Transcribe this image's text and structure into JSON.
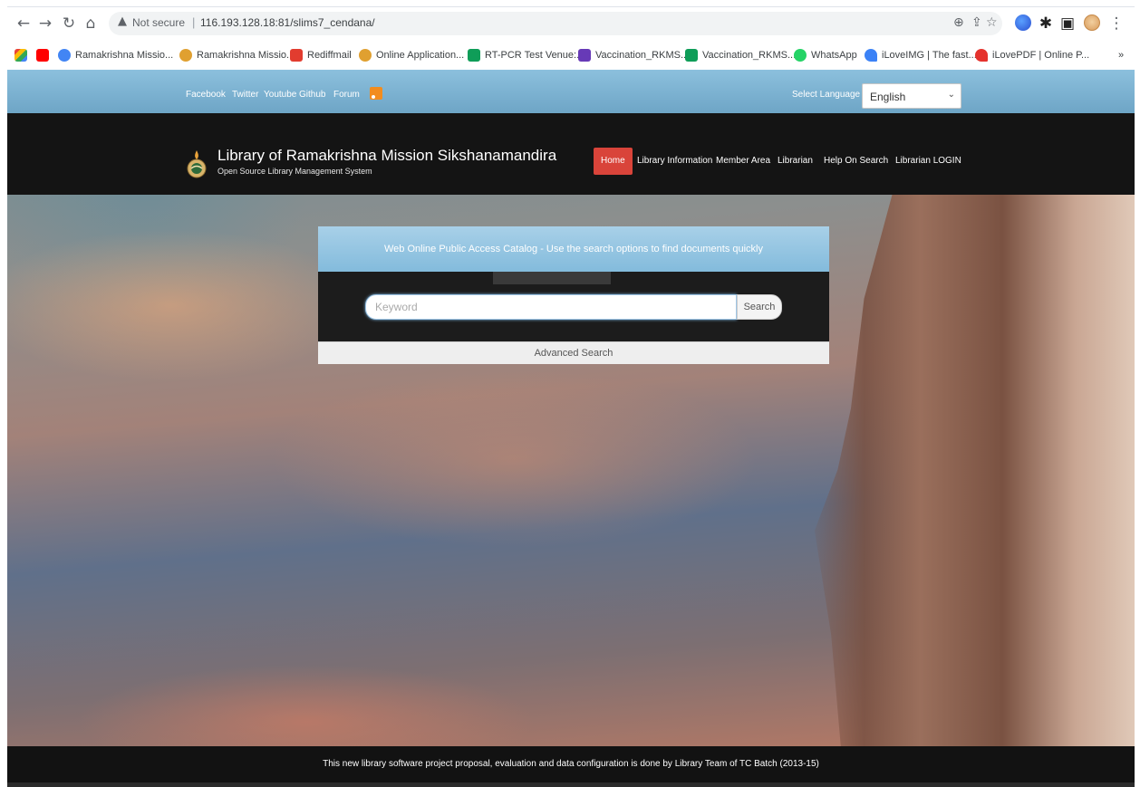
{
  "browser": {
    "security_label": "Not secure",
    "url": "116.193.128.18:81/slims7_cendana/",
    "bookmarks": [
      {
        "label": "Ramakrishna Missio...",
        "color": "#4285f4"
      },
      {
        "label": "Ramakrishna Missio...",
        "color": "#e0a030"
      },
      {
        "label": "Rediffmail",
        "color": "#e23c2f"
      },
      {
        "label": "Online Application...",
        "color": "#e0a030"
      },
      {
        "label": "RT-PCR Test Venue:...",
        "color": "#0f9d58"
      },
      {
        "label": "Vaccination_RKMS...",
        "color": "#673ab7"
      },
      {
        "label": "Vaccination_RKMS...",
        "color": "#0f9d58"
      },
      {
        "label": "WhatsApp",
        "color": "#25d366"
      },
      {
        "label": "iLoveIMG | The fast...",
        "color": "#3b82f6"
      },
      {
        "label": "iLovePDF | Online P...",
        "color": "#e5322d"
      }
    ],
    "more_bookmarks": "»"
  },
  "site": {
    "social_links": [
      "Facebook",
      "Twitter",
      "Youtube",
      "Github",
      "Forum"
    ],
    "language_label": "Select Language",
    "language_value": "English",
    "title": "Library of Ramakrishna Mission Sikshanamandira",
    "subtitle": "Open Source Library Management System",
    "menu": [
      "Home",
      "Library Information",
      "Member Area",
      "Librarian",
      "Help On Search",
      "Librarian LOGIN"
    ],
    "opac_heading": "Web Online Public Access Catalog - Use the search options to find documents quickly",
    "search_placeholder": "Keyword",
    "search_button": "Search",
    "advanced_search": "Advanced Search",
    "footer_text": "This new library software project proposal, evaluation and data configuration is done by Library Team of TC Batch (2013-15)"
  },
  "colors": {
    "accent_active_menu": "#d9443a",
    "topbar": "#7fb4d4",
    "header_bg": "#141414"
  }
}
